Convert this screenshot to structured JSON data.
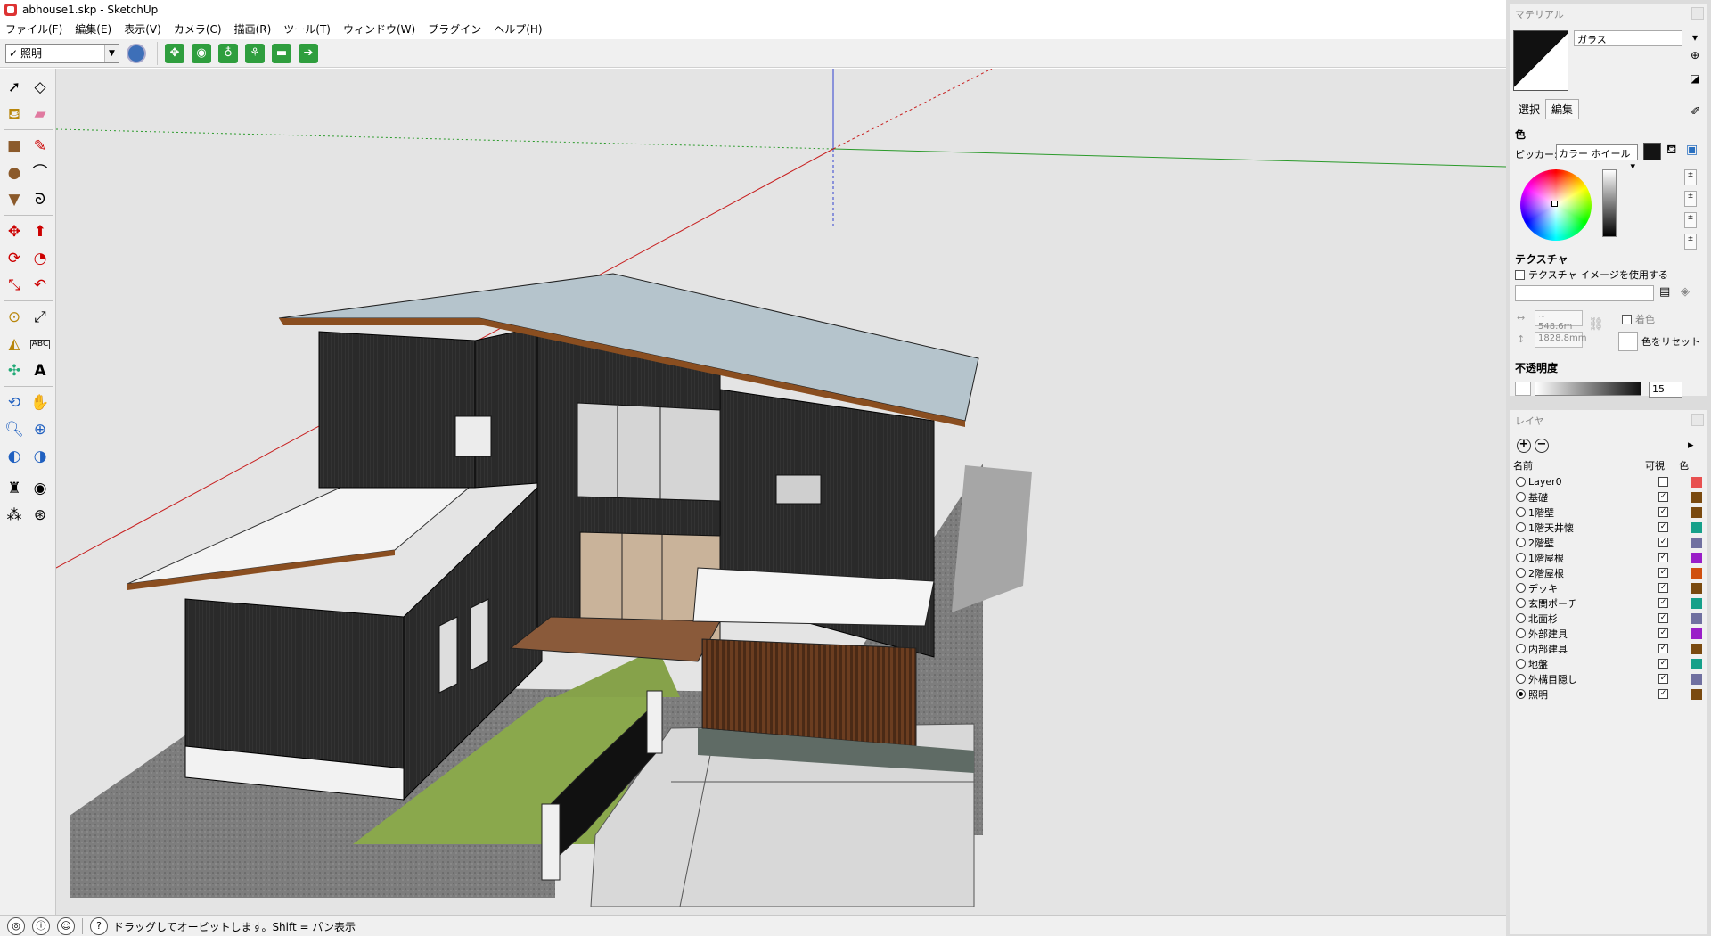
{
  "window": {
    "title": "abhouse1.skp - SketchUp"
  },
  "menu": [
    "ファイル(F)",
    "編集(E)",
    "表示(V)",
    "カメラ(C)",
    "描画(R)",
    "ツール(T)",
    "ウィンドウ(W)",
    "プラグイン",
    "ヘルプ(H)"
  ],
  "toolbar": {
    "scene_value": "照明"
  },
  "status": {
    "hint": "ドラッグしてオービットします。Shift = パン表示"
  },
  "materials": {
    "title": "マテリアル",
    "name": "ガラス",
    "tabs": [
      "選択",
      "編集"
    ],
    "color_heading": "色",
    "picker_label": "ピッカー:",
    "picker_value": "カラー ホイール",
    "texture_heading": "テクスチャ",
    "use_texture_label": "テクスチャ イメージを使用する",
    "width_value": "~ 548.6m",
    "height_value": "1828.8mm",
    "colorize_label": "着色",
    "reset_color_label": "色をリセット",
    "opacity_heading": "不透明度",
    "opacity_value": "15"
  },
  "layers": {
    "title": "レイヤ",
    "columns": {
      "name": "名前",
      "visible": "可視",
      "color": "色"
    },
    "items": [
      {
        "name": "Layer0",
        "visible": false,
        "color": "#e85050",
        "active": false
      },
      {
        "name": "基礎",
        "visible": true,
        "color": "#7a4a10",
        "active": false
      },
      {
        "name": "1階壁",
        "visible": true,
        "color": "#7a4a10",
        "active": false
      },
      {
        "name": "1階天井懐",
        "visible": true,
        "color": "#16a08a",
        "active": false
      },
      {
        "name": "2階壁",
        "visible": true,
        "color": "#7070a0",
        "active": false
      },
      {
        "name": "1階屋根",
        "visible": true,
        "color": "#9a1ec8",
        "active": false
      },
      {
        "name": "2階屋根",
        "visible": true,
        "color": "#d05010",
        "active": false
      },
      {
        "name": "デッキ",
        "visible": true,
        "color": "#7a4a10",
        "active": false
      },
      {
        "name": "玄関ポーチ",
        "visible": true,
        "color": "#16a08a",
        "active": false
      },
      {
        "name": "北面杉",
        "visible": true,
        "color": "#7070a0",
        "active": false
      },
      {
        "name": "外部建具",
        "visible": true,
        "color": "#9a1ec8",
        "active": false
      },
      {
        "name": "内部建具",
        "visible": true,
        "color": "#7a4a10",
        "active": false
      },
      {
        "name": "地盤",
        "visible": true,
        "color": "#16a08a",
        "active": false
      },
      {
        "name": "外構目隠し",
        "visible": true,
        "color": "#7070a0",
        "active": false
      },
      {
        "name": "照明",
        "visible": true,
        "color": "#7a4a10",
        "active": true
      }
    ]
  }
}
